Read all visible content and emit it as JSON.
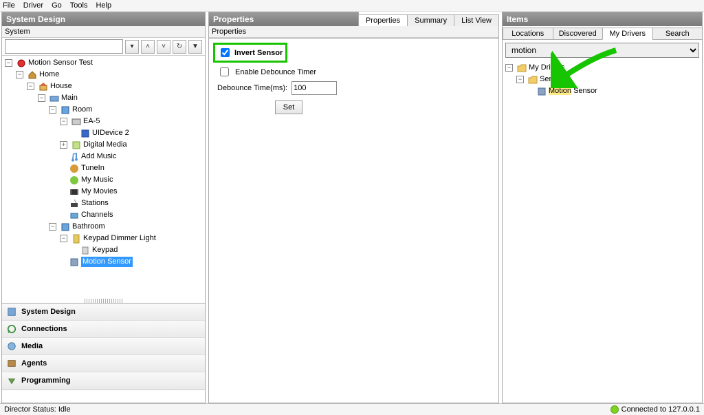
{
  "menu": {
    "file": "File",
    "driver": "Driver",
    "go": "Go",
    "tools": "Tools",
    "help": "Help"
  },
  "left": {
    "title": "System Design",
    "sub": "System",
    "toolbar": {
      "search_val": "",
      "up": "˄",
      "down": "˅",
      "refresh": "↻",
      "filter": "▼"
    },
    "tree": {
      "root": "Motion Sensor Test",
      "home": "Home",
      "house": "House",
      "main": "Main",
      "room": "Room",
      "ea5": "EA-5",
      "uidev": "UIDevice 2",
      "digmed": "Digital Media",
      "addmusic": "Add Music",
      "tunein": "TuneIn",
      "mymusic": "My Music",
      "mymovies": "My Movies",
      "stations": "Stations",
      "channels": "Channels",
      "bathroom": "Bathroom",
      "keypadlight": "Keypad Dimmer Light",
      "keypad": "Keypad",
      "motion": "Motion Sensor"
    },
    "nav": {
      "sd": "System Design",
      "conn": "Connections",
      "media": "Media",
      "agents": "Agents",
      "prog": "Programming"
    }
  },
  "mid": {
    "title": "Properties",
    "tabs": {
      "props": "Properties",
      "summary": "Summary",
      "list": "List View"
    },
    "sub": "Properties",
    "invert": "Invert Sensor",
    "invert_checked": true,
    "debounce_enable": "Enable Debounce Timer",
    "debounce_enable_checked": false,
    "debounce_label": "Debounce Time(ms):",
    "debounce_val": "100",
    "set": "Set"
  },
  "right": {
    "title": "Items",
    "tabs": {
      "loc": "Locations",
      "disc": "Discovered",
      "mydrv": "My Drivers",
      "search": "Search"
    },
    "search_val": "motion",
    "tree": {
      "root": "My Drivers",
      "sensors": "Sensors",
      "motionfull": "Motion Sensor",
      "motion_hl": "Motion"
    }
  },
  "status": {
    "left": "Director Status: Idle",
    "right": "Connected to 127.0.0.1"
  }
}
